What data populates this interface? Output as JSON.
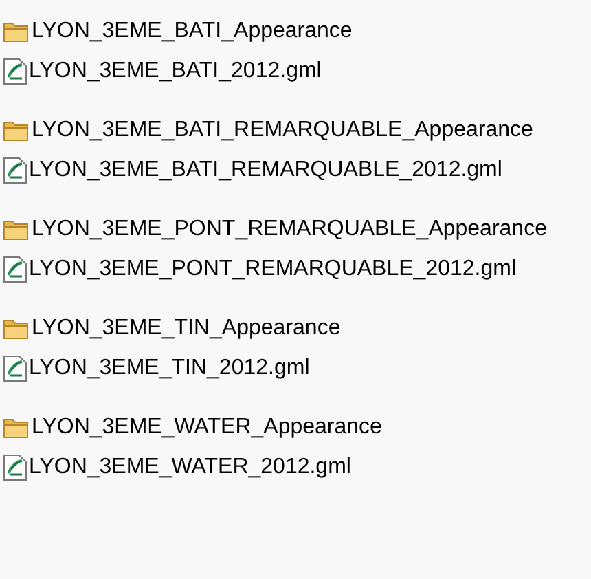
{
  "groups": [
    {
      "items": [
        {
          "kind": "folder",
          "name": "LYON_3EME_BATI_Appearance"
        },
        {
          "kind": "gml",
          "name": "LYON_3EME_BATI_2012.gml"
        }
      ]
    },
    {
      "items": [
        {
          "kind": "folder",
          "name": "LYON_3EME_BATI_REMARQUABLE_Appearance"
        },
        {
          "kind": "gml",
          "name": "LYON_3EME_BATI_REMARQUABLE_2012.gml"
        }
      ]
    },
    {
      "items": [
        {
          "kind": "folder",
          "name": "LYON_3EME_PONT_REMARQUABLE_Appearance"
        },
        {
          "kind": "gml",
          "name": "LYON_3EME_PONT_REMARQUABLE_2012.gml"
        }
      ]
    },
    {
      "items": [
        {
          "kind": "folder",
          "name": "LYON_3EME_TIN_Appearance"
        },
        {
          "kind": "gml",
          "name": "LYON_3EME_TIN_2012.gml"
        }
      ]
    },
    {
      "items": [
        {
          "kind": "folder",
          "name": "LYON_3EME_WATER_Appearance"
        },
        {
          "kind": "gml",
          "name": "LYON_3EME_WATER_2012.gml"
        }
      ]
    }
  ]
}
